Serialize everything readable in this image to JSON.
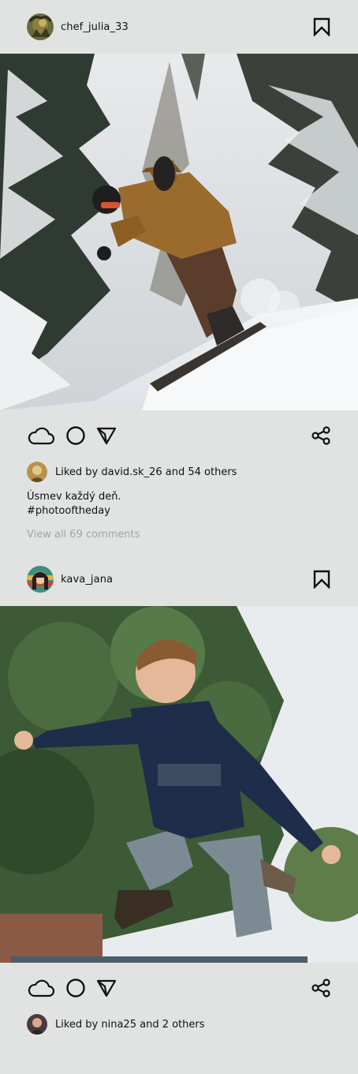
{
  "posts": [
    {
      "username": "chef_julia_33",
      "likes_text": "Liked by david.sk_26 and 54 others",
      "caption_line1": "Úsmev každý deň.",
      "caption_line2": "#photooftheday",
      "comments_link": "View all 69 comments",
      "photo_icon": "snowboarder-photo"
    },
    {
      "username": "kava_jana",
      "likes_text": "Liked by nina25 and 2 others",
      "photo_icon": "boy-jumping-photo"
    }
  ],
  "icons": {
    "bookmark": "bookmark-icon",
    "like": "cloud-icon",
    "comment": "circle-icon",
    "send": "send-icon",
    "share": "share-icon"
  },
  "colors": {
    "background": "#e1e3e2",
    "muted_text": "#a3a5a6"
  }
}
